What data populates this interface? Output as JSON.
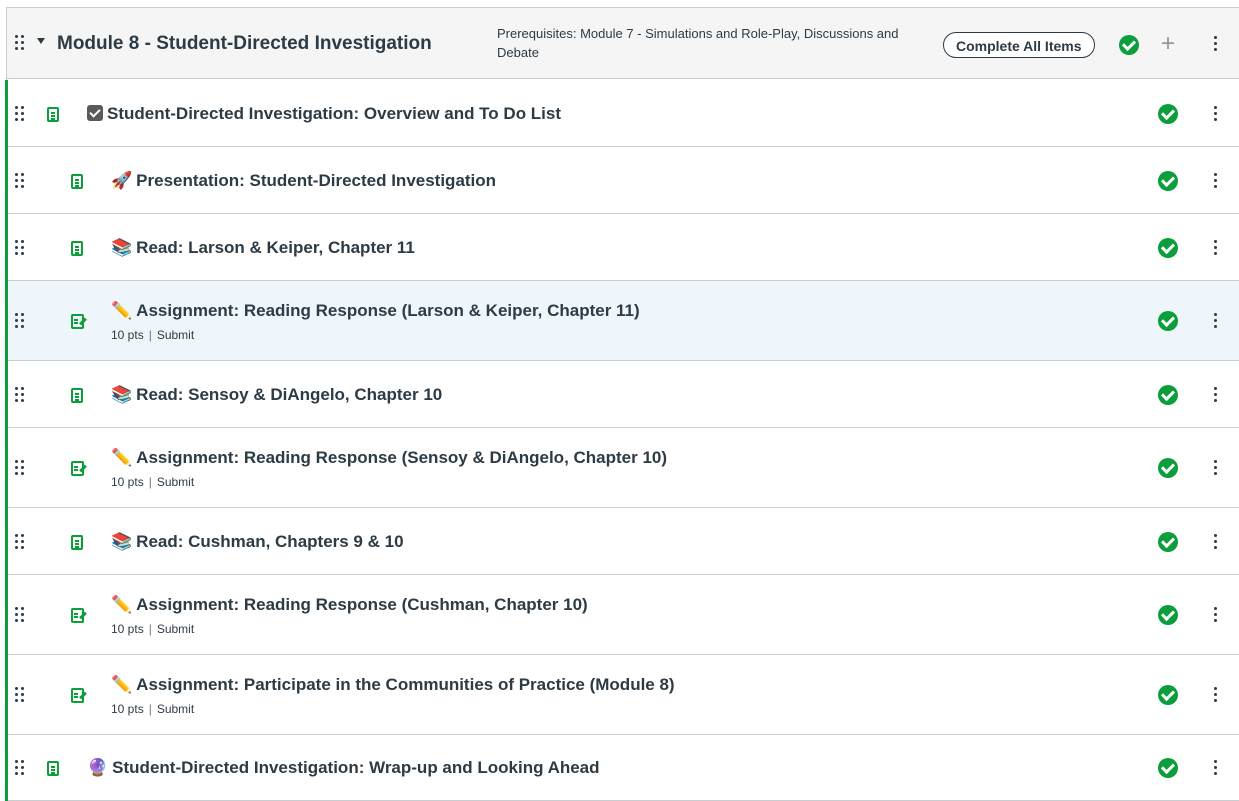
{
  "module": {
    "title": "Module 8 - Student-Directed Investigation",
    "prerequisites": "Prerequisites: Module 7 - Simulations and Role-Play, Discussions and Debate",
    "complete_label": "Complete All Items",
    "status_color": "#0b9e3b",
    "icons": [
      "drag-handle-icon",
      "collapse-caret-icon",
      "check-circle-icon",
      "plus-icon",
      "kebab-menu-icon"
    ]
  },
  "items": [
    {
      "type": "page",
      "emoji": "check-box",
      "title": "Student-Directed Investigation: Overview and To Do List",
      "indent": 0
    },
    {
      "type": "page",
      "emoji": "🚀",
      "title": "Presentation: Student-Directed Investigation",
      "indent": 1
    },
    {
      "type": "page",
      "emoji": "📚",
      "title": "Read: Larson & Keiper, Chapter 11",
      "indent": 1
    },
    {
      "type": "assignment",
      "emoji": "✏️",
      "title": "Assignment: Reading Response (Larson & Keiper, Chapter 11)",
      "points": "10 pts",
      "action": "Submit",
      "indent": 1,
      "highlighted": true
    },
    {
      "type": "page",
      "emoji": "📚",
      "title": "Read: Sensoy & DiAngelo, Chapter 10",
      "indent": 1
    },
    {
      "type": "assignment",
      "emoji": "✏️",
      "title": "Assignment: Reading Response (Sensoy & DiAngelo, Chapter 10)",
      "points": "10 pts",
      "action": "Submit",
      "indent": 1
    },
    {
      "type": "page",
      "emoji": "📚",
      "title": "Read: Cushman, Chapters 9 & 10",
      "indent": 1
    },
    {
      "type": "assignment",
      "emoji": "✏️",
      "title": "Assignment: Reading Response (Cushman, Chapter 10)",
      "points": "10 pts",
      "action": "Submit",
      "indent": 1
    },
    {
      "type": "assignment",
      "emoji": "✏️",
      "title": "Assignment: Participate in the Communities of Practice (Module 8)",
      "points": "10 pts",
      "action": "Submit",
      "indent": 1
    },
    {
      "type": "page",
      "emoji": "🔮",
      "title": "Student-Directed Investigation: Wrap-up and Looking Ahead",
      "indent": 0
    }
  ]
}
